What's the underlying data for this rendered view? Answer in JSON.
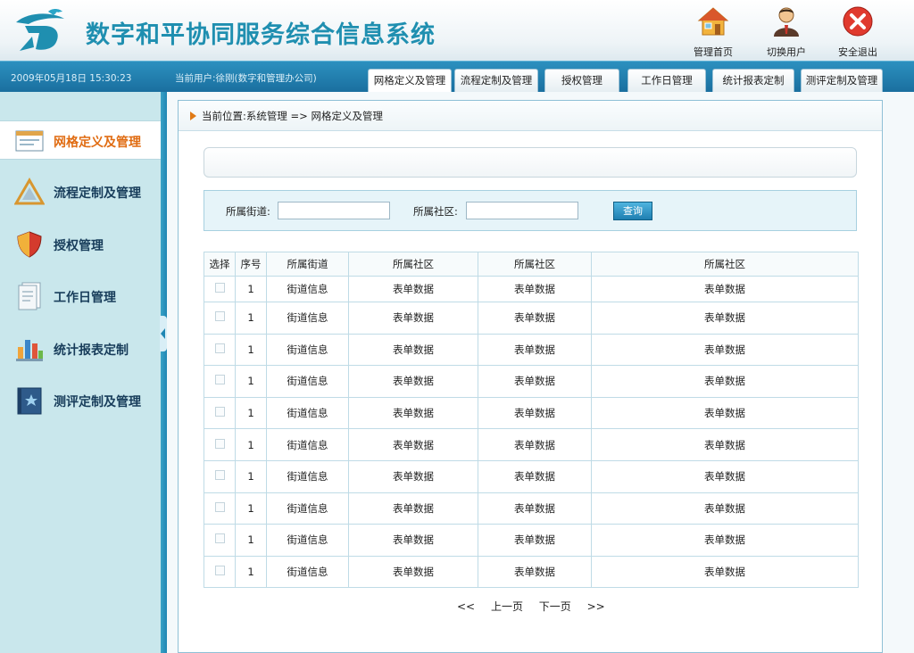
{
  "header": {
    "title": "数字和平协同服务综合信息系统",
    "buttons": [
      {
        "label": "管理首页",
        "icon": "house-icon"
      },
      {
        "label": "切换用户",
        "icon": "user-icon"
      },
      {
        "label": "安全退出",
        "icon": "exit-icon"
      }
    ]
  },
  "status": {
    "datetime": "2009年05月18日 15:30:23",
    "current_user": "当前用户:徐刚(数字和管理办公司)"
  },
  "tabs": [
    {
      "label": "网格定义及管理",
      "active": true
    },
    {
      "label": "流程定制及管理"
    },
    {
      "label": "授权管理"
    },
    {
      "label": "工作日管理"
    },
    {
      "label": "统计报表定制"
    },
    {
      "label": "测评定制及管理"
    }
  ],
  "sidebar": {
    "items": [
      {
        "label": "网格定义及管理",
        "icon": "window-icon",
        "active": true
      },
      {
        "label": "流程定制及管理",
        "icon": "triangle-ruler-icon"
      },
      {
        "label": "授权管理",
        "icon": "shield-icon"
      },
      {
        "label": "工作日管理",
        "icon": "document-icon"
      },
      {
        "label": "统计报表定制",
        "icon": "bar-chart-icon"
      },
      {
        "label": "测评定制及管理",
        "icon": "star-book-icon"
      }
    ]
  },
  "breadcrumb": "当前位置:系统管理 => 网格定义及管理",
  "search": {
    "street_label": "所属街道:",
    "street_value": "",
    "community_label": "所属社区:",
    "community_value": "",
    "button": "查询"
  },
  "table": {
    "headers": [
      "选择",
      "序号",
      "所属街道",
      "所属社区",
      "所属社区",
      "所属社区"
    ],
    "rows": [
      {
        "no": "1",
        "street": "街道信息",
        "c1": "表单数据",
        "c2": "表单数据",
        "c3": "表单数据"
      },
      {
        "no": "1",
        "street": "街道信息",
        "c1": "表单数据",
        "c2": "表单数据",
        "c3": "表单数据"
      },
      {
        "no": "1",
        "street": "街道信息",
        "c1": "表单数据",
        "c2": "表单数据",
        "c3": "表单数据"
      },
      {
        "no": "1",
        "street": "街道信息",
        "c1": "表单数据",
        "c2": "表单数据",
        "c3": "表单数据"
      },
      {
        "no": "1",
        "street": "街道信息",
        "c1": "表单数据",
        "c2": "表单数据",
        "c3": "表单数据"
      },
      {
        "no": "1",
        "street": "街道信息",
        "c1": "表单数据",
        "c2": "表单数据",
        "c3": "表单数据"
      },
      {
        "no": "1",
        "street": "街道信息",
        "c1": "表单数据",
        "c2": "表单数据",
        "c3": "表单数据"
      },
      {
        "no": "1",
        "street": "街道信息",
        "c1": "表单数据",
        "c2": "表单数据",
        "c3": "表单数据"
      },
      {
        "no": "1",
        "street": "街道信息",
        "c1": "表单数据",
        "c2": "表单数据",
        "c3": "表单数据"
      },
      {
        "no": "1",
        "street": "街道信息",
        "c1": "表单数据",
        "c2": "表单数据",
        "c3": "表单数据"
      }
    ]
  },
  "pager": {
    "first": "<<",
    "prev": "上一页",
    "next": "下一页",
    "last": ">>"
  },
  "colors": {
    "accent": "#1f8fb0",
    "statusbar": "#1f7fb1",
    "sidebar": "#c9e7ec",
    "active_text": "#e06c12"
  }
}
